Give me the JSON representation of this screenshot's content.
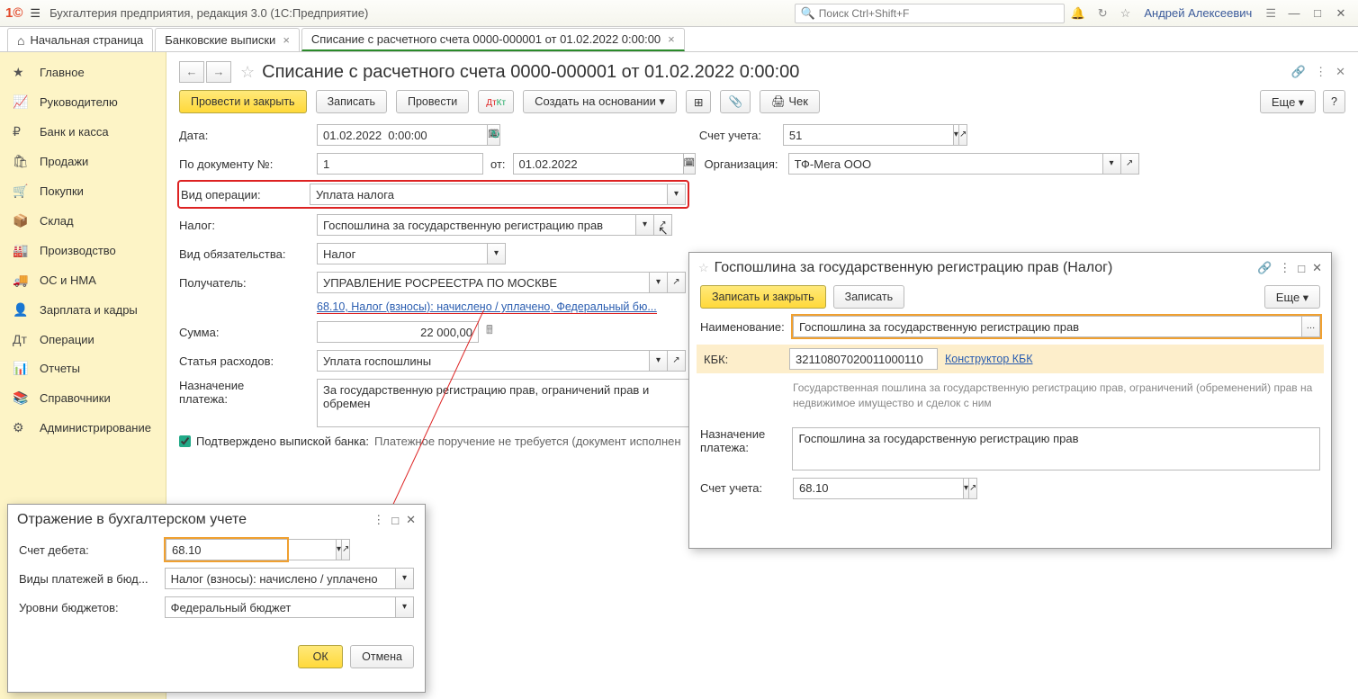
{
  "app": {
    "title": "Бухгалтерия предприятия, редакция 3.0  (1С:Предприятие)",
    "search_ph": "Поиск Ctrl+Shift+F",
    "user": "Андрей Алексеевич"
  },
  "tabs": {
    "home": "Начальная страница",
    "t1": "Банковские выписки",
    "t2": "Списание с расчетного счета 0000-000001 от 01.02.2022 0:00:00"
  },
  "sidebar": {
    "items": [
      {
        "icon": "★",
        "label": "Главное"
      },
      {
        "icon": "📈",
        "label": "Руководителю"
      },
      {
        "icon": "₽",
        "label": "Банк и касса"
      },
      {
        "icon": "🛍",
        "label": "Продажи"
      },
      {
        "icon": "🛒",
        "label": "Покупки"
      },
      {
        "icon": "📦",
        "label": "Склад"
      },
      {
        "icon": "🏭",
        "label": "Производство"
      },
      {
        "icon": "🚚",
        "label": "ОС и НМА"
      },
      {
        "icon": "👤",
        "label": "Зарплата и кадры"
      },
      {
        "icon": "Дт",
        "label": "Операции"
      },
      {
        "icon": "📊",
        "label": "Отчеты"
      },
      {
        "icon": "📚",
        "label": "Справочники"
      },
      {
        "icon": "⚙",
        "label": "Администрирование"
      }
    ]
  },
  "doc": {
    "title": "Списание с расчетного счета 0000-000001 от 01.02.2022 0:00:00",
    "btn_post_close": "Провести и закрыть",
    "btn_write": "Записать",
    "btn_post": "Провести",
    "btn_base": "Создать на основании",
    "btn_check": "Чек",
    "btn_more": "Еще",
    "date_lbl": "Дата:",
    "date": "01.02.2022  0:00:00",
    "acct_lbl": "Счет учета:",
    "acct": "51",
    "docnum_lbl": "По документу №:",
    "docnum": "1",
    "from_lbl": "от:",
    "from": "01.02.2022",
    "org_lbl": "Организация:",
    "org": "ТФ-Мега ООО",
    "op_lbl": "Вид операции:",
    "op": "Уплата налога",
    "tax_lbl": "Налог:",
    "tax": "Госпошлина за государственную регистрацию прав",
    "obl_lbl": "Вид обязательства:",
    "obl": "Налог",
    "recv_lbl": "Получатель:",
    "recv": "УПРАВЛЕНИЕ РОСРЕЕСТРА ПО МОСКВЕ",
    "acc_link": "68.10, Налог (взносы): начислено / уплачено, Федеральный бю...",
    "sum_lbl": "Сумма:",
    "sum": "22 000,00",
    "exp_lbl": "Статья расходов:",
    "exp": "Уплата госпошлины",
    "purpose_lbl": "Назначение\nплатежа:",
    "purpose": "За государственную регистрацию прав, ограничений прав и обремен",
    "confirmed": "Подтверждено выпиской банка:",
    "confirmed_txt": "Платежное поручение не требуется (документ исполнен"
  },
  "pop1": {
    "title": "Отражение в бухгалтерском учете",
    "debit_lbl": "Счет дебета:",
    "debit": "68.10",
    "kind_lbl": "Виды платежей в бюд...",
    "kind": "Налог (взносы): начислено / уплачено",
    "level_lbl": "Уровни бюджетов:",
    "level": "Федеральный бюджет",
    "ok": "ОК",
    "cancel": "Отмена"
  },
  "pop2": {
    "title": "Госпошлина за государственную регистрацию прав (Налог)",
    "btn_wc": "Записать и закрыть",
    "btn_w": "Записать",
    "btn_more": "Еще",
    "name_lbl": "Наименование:",
    "name": "Госпошлина за государственную регистрацию прав",
    "kbk_lbl": "КБК:",
    "kbk": "32110807020011000110",
    "kbk_link": "Конструктор КБК",
    "desc": "Государственная пошлина за государственную регистрацию прав, ограничений (обременений) прав на недвижимое имущество и сделок с ним",
    "purpose_lbl": "Назначение\nплатежа:",
    "purpose": "Госпошлина за государственную регистрацию прав",
    "acct_lbl": "Счет учета:",
    "acct": "68.10"
  }
}
